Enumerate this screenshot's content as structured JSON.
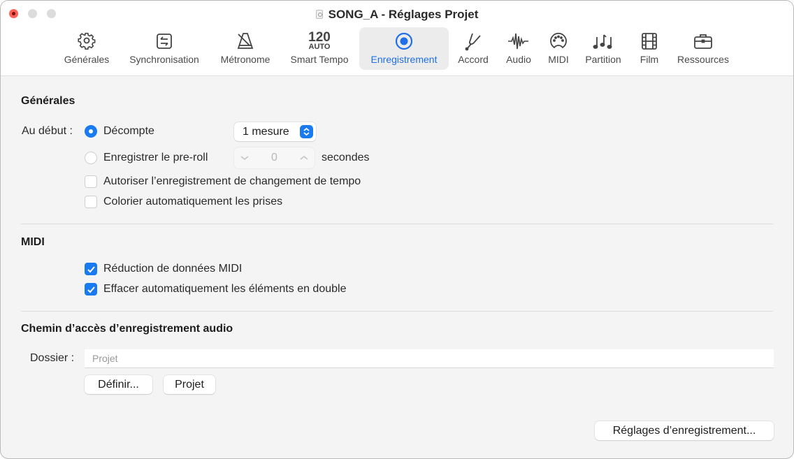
{
  "window": {
    "title": "SONG_A - Réglages Projet",
    "title_icon": "document-icon"
  },
  "toolbar": {
    "tabs": [
      {
        "label": "Générales",
        "icon": "gear-icon"
      },
      {
        "label": "Synchronisation",
        "icon": "sync-icon"
      },
      {
        "label": "Métronome",
        "icon": "metronome-icon"
      },
      {
        "label": "Smart Tempo",
        "icon": "tempo-icon",
        "tempo_value": "120",
        "tempo_mode": "AUTO"
      },
      {
        "label": "Enregistrement",
        "icon": "record-icon",
        "active": true
      },
      {
        "label": "Accord",
        "icon": "tuning-fork-icon"
      },
      {
        "label": "Audio",
        "icon": "waveform-icon"
      },
      {
        "label": "MIDI",
        "icon": "midi-port-icon"
      },
      {
        "label": "Partition",
        "icon": "music-notes-icon"
      },
      {
        "label": "Film",
        "icon": "film-icon"
      },
      {
        "label": "Ressources",
        "icon": "briefcase-icon"
      }
    ],
    "accent_color": "#1f6fe6"
  },
  "general": {
    "title": "Générales",
    "start_label": "Au début :",
    "countin_label": "Décompte",
    "countin_selected": true,
    "countin_value": "1 mesure",
    "preroll_label": "Enregistrer le pre-roll",
    "preroll_selected": false,
    "preroll_value": "0",
    "preroll_unit": "secondes",
    "tempo_change_label": "Autoriser l’enregistrement de changement de tempo",
    "tempo_change_checked": false,
    "auto_color_label": "Colorier automatiquement les prises",
    "auto_color_checked": false
  },
  "midi": {
    "title": "MIDI",
    "data_reduction_label": "Réduction de données MIDI",
    "data_reduction_checked": true,
    "auto_delete_label": "Effacer automatiquement les éléments en double",
    "auto_delete_checked": true
  },
  "audio_path": {
    "title": "Chemin d’accès d’enregistrement audio",
    "folder_label": "Dossier :",
    "folder_value": "Projet",
    "define_button": "Définir...",
    "project_button": "Projet"
  },
  "footer": {
    "recording_settings_button": "Réglages d’enregistrement..."
  }
}
